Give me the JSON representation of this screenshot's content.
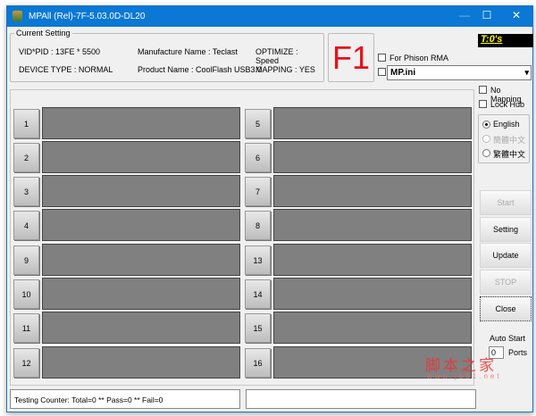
{
  "window": {
    "title": "MPAll (Rel)-7F-5.03.0D-DL20",
    "minimize": "—",
    "maximize": "☐",
    "close": "✕"
  },
  "current_setting": {
    "label": "Current Setting",
    "vidpid": "VID*PID : 13FE * 5500",
    "device_type": "DEVICE TYPE : NORMAL",
    "manufacture": "Manufacture Name : Teclast",
    "product": "Product Name : CoolFlash USB3.0",
    "optimize": "OPTIMIZE : Speed",
    "mapping": "MAPPING : YES"
  },
  "f1": "F1",
  "timer": "T:0's",
  "for_phison_rma": "For Phison RMA",
  "ini_select": {
    "value": "MP.ini",
    "arrow": "▾"
  },
  "no_mapping": "No Mapping",
  "lock_hub": "Lock Hub",
  "languages": [
    {
      "label": "English",
      "selected": true,
      "enabled": true
    },
    {
      "label": "簡體中文",
      "selected": false,
      "enabled": false
    },
    {
      "label": "繁體中文",
      "selected": false,
      "enabled": true
    }
  ],
  "ports": [
    "1",
    "2",
    "3",
    "4",
    "5",
    "6",
    "7",
    "8",
    "9",
    "10",
    "11",
    "12",
    "13",
    "14",
    "15",
    "16"
  ],
  "buttons": {
    "start": "Start",
    "setting": "Setting",
    "update": "Update",
    "stop": "STOP",
    "close": "Close"
  },
  "auto_start": {
    "label": "Auto Start",
    "value": "0",
    "ports_label": "Ports"
  },
  "status": {
    "counter": "Testing Counter: Total=0 ** Pass=0 ** Fail=0",
    "right": ""
  },
  "watermark": {
    "cn": "脚本之家",
    "url": "www.jb51.net"
  }
}
